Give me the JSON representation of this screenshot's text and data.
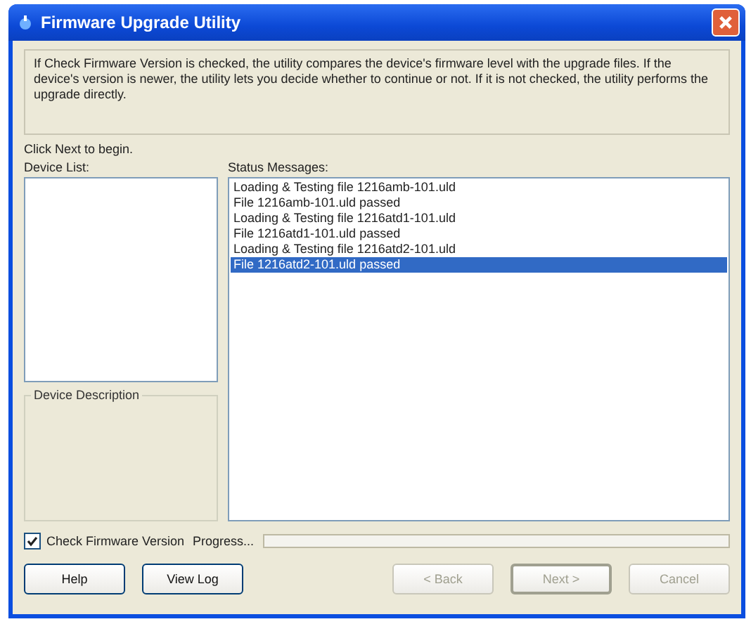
{
  "window": {
    "title": "Firmware Upgrade Utility"
  },
  "info": "If Check Firmware Version is checked, the utility compares the device's firmware level with the upgrade files. If the device's version is newer, the utility lets you decide whether to continue or not. If it is not checked, the utility performs the upgrade directly.",
  "instruction": "Click Next to begin.",
  "device_list": {
    "label": "Device List:"
  },
  "device_description": {
    "label": "Device Description"
  },
  "status_messages": {
    "label": "Status Messages:",
    "items": [
      {
        "text": "Loading & Testing file 1216amb-101.uld",
        "selected": false
      },
      {
        "text": "File 1216amb-101.uld passed",
        "selected": false
      },
      {
        "text": "Loading & Testing file 1216atd1-101.uld",
        "selected": false
      },
      {
        "text": "File 1216atd1-101.uld passed",
        "selected": false
      },
      {
        "text": "Loading & Testing file 1216atd2-101.uld",
        "selected": false
      },
      {
        "text": "File 1216atd2-101.uld passed",
        "selected": true
      }
    ]
  },
  "check_firmware": {
    "label": "Check Firmware Version",
    "checked": true
  },
  "progress": {
    "label": "Progress...",
    "level": 0
  },
  "buttons": [
    {
      "label": "Help",
      "disabled": false,
      "default": false
    },
    {
      "label": "View Log",
      "disabled": false,
      "default": false
    },
    {
      "label": "< Back",
      "disabled": true,
      "default": false
    },
    {
      "label": "Next >",
      "disabled": true,
      "default": true
    },
    {
      "label": "Cancel",
      "disabled": true,
      "default": false
    }
  ]
}
